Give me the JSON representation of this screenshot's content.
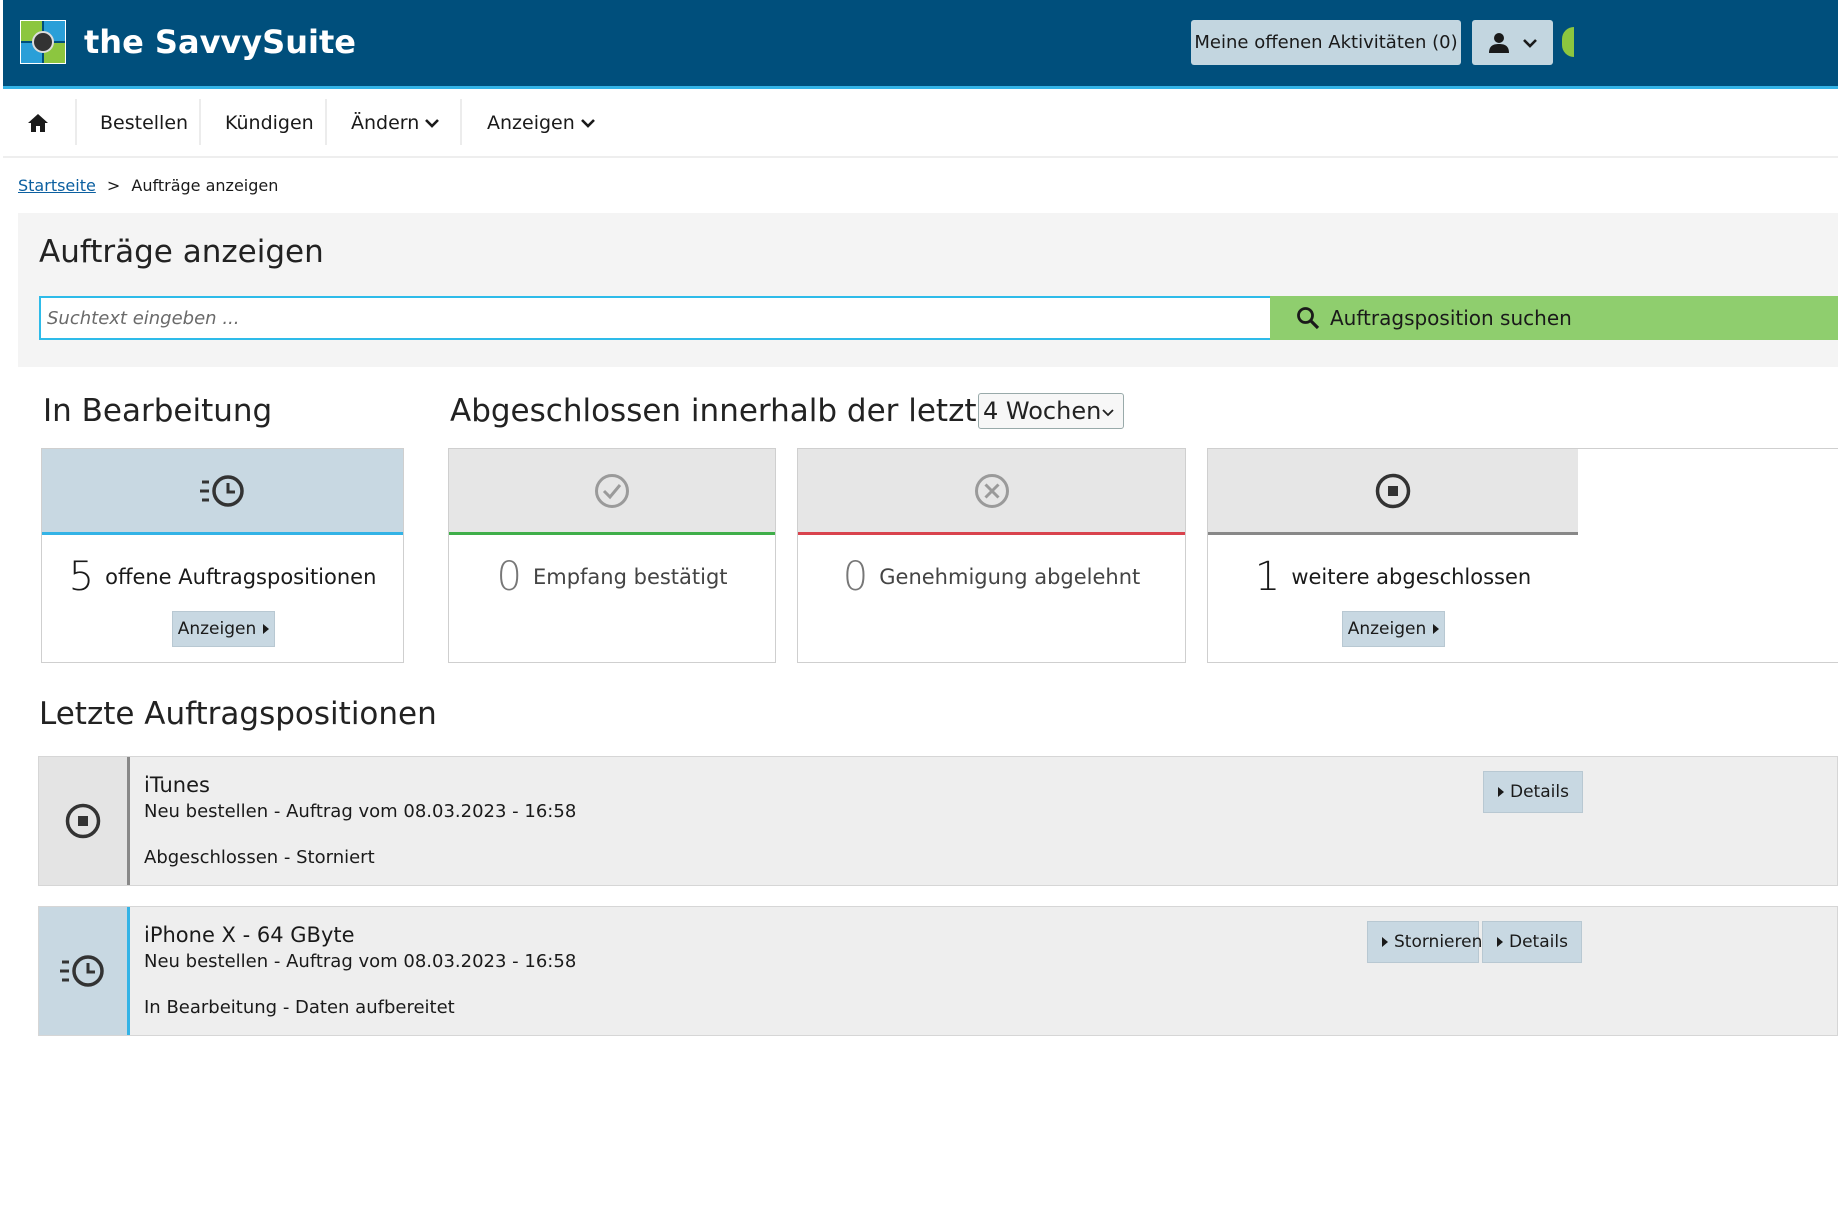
{
  "header": {
    "brand": "the SavvySuite",
    "activities_label": "Meine offenen Aktivitäten (0)",
    "user_icon": "user-icon",
    "colors": {
      "header_bg": "#004f7c",
      "accent": "#33b3e6",
      "search_button": "#8fce6e"
    }
  },
  "nav": {
    "home_icon": "home-icon",
    "items": [
      {
        "label": "Bestellen"
      },
      {
        "label": "Kündigen"
      },
      {
        "label": "Ändern"
      },
      {
        "label": "Anzeigen"
      }
    ]
  },
  "breadcrumb": {
    "home": "Startseite",
    "separator": ">",
    "current": "Aufträge anzeigen"
  },
  "main": {
    "title": "Aufträge anzeigen",
    "search": {
      "placeholder": "Suchtext eingeben ...",
      "value": "",
      "button_label": "Auftragsposition suchen"
    }
  },
  "status": {
    "in_progress_title": "In Bearbeitung",
    "completed_title": "Abgeschlossen innerhalb der letzten",
    "period_select": "4 Wochen",
    "cards": [
      {
        "count": "5",
        "label": "offene Auftragspositionen",
        "button": "Anzeigen",
        "icon": "clock-history-icon",
        "color": "#33b3e6"
      },
      {
        "count": "0",
        "label": "Empfang bestätigt",
        "icon": "check-circle-icon",
        "color": "#3fae49"
      },
      {
        "count": "0",
        "label": "Genehmigung abgelehnt",
        "icon": "x-circle-icon",
        "color": "#d9434d"
      },
      {
        "count": "1",
        "label": "weitere abgeschlossen",
        "button": "Anzeigen",
        "icon": "stop-circle-icon",
        "color": "#888888"
      }
    ]
  },
  "recent": {
    "title": "Letzte Auftragspositionen",
    "items": [
      {
        "title": "iTunes",
        "subtitle": "Neu bestellen - Auftrag vom 08.03.2023 - 16:58",
        "status": "Abgeschlossen - Storniert",
        "icon": "stop-circle-icon",
        "details": "Details"
      },
      {
        "title": "iPhone X - 64 GByte",
        "subtitle": "Neu bestellen - Auftrag vom 08.03.2023 - 16:58",
        "status": "In Bearbeitung - Daten aufbereitet",
        "icon": "clock-history-icon",
        "cancel": "Stornieren",
        "details": "Details"
      }
    ]
  }
}
